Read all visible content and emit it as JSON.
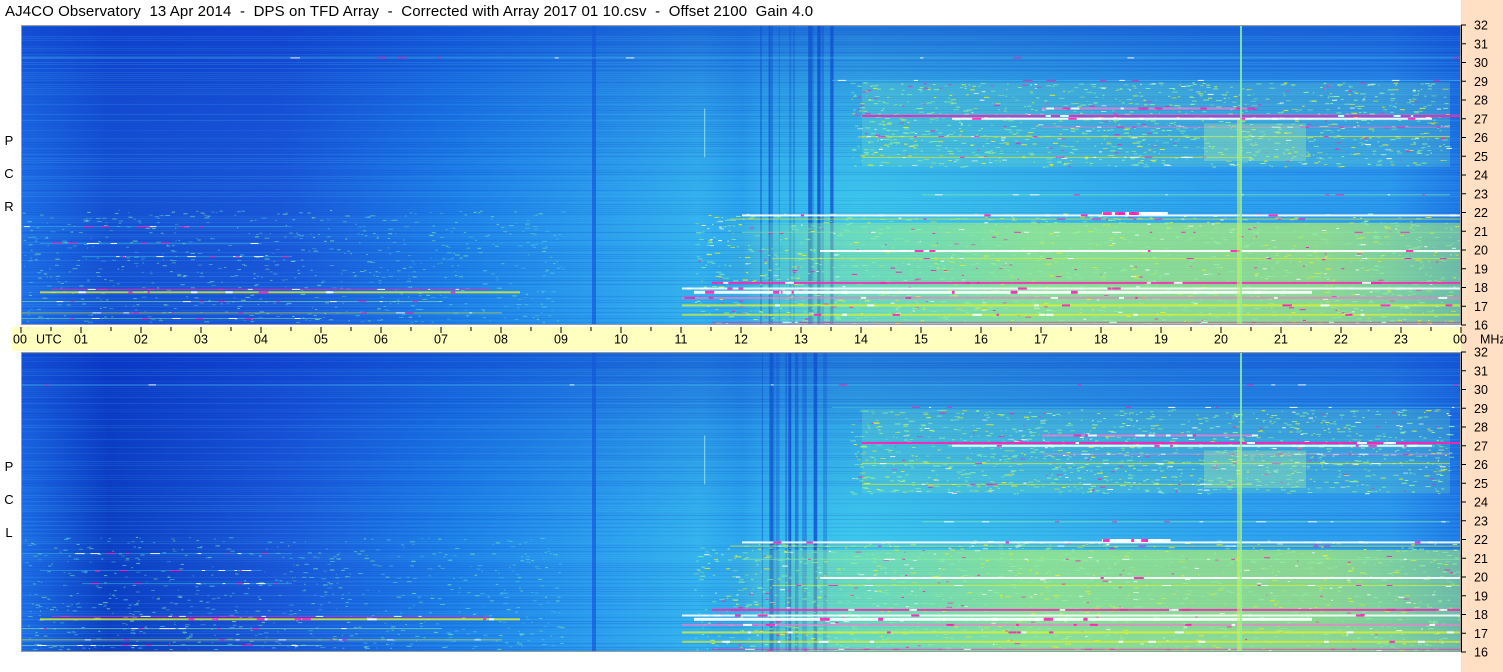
{
  "title": "AJ4CO Observatory  13 Apr 2014  -  DPS on TFD Array  -  Corrected with Array 2017 01 10.csv  -  Offset 2100  Gain 4.0",
  "colors": {
    "background": "#ffffff",
    "time_band": "#ffffc0",
    "right_strip": "#ffe0c4",
    "colormap": [
      "#0a2fb8",
      "#1560e0",
      "#1f8fef",
      "#2aa8ef",
      "#3ccfe8",
      "#8ff0a0",
      "#e8f020",
      "#f07ad0",
      "#ff1fb4",
      "#ffffff"
    ]
  },
  "chart_data": {
    "type": "heatmap",
    "title": "AJ4CO Observatory  13 Apr 2014  -  DPS on TFD Array  -  Corrected with Array 2017 01 10.csv  -  Offset 2100  Gain 4.0",
    "x_axis": {
      "unit_label": "UTC",
      "ticks": [
        "00",
        "01",
        "02",
        "03",
        "04",
        "05",
        "06",
        "07",
        "08",
        "09",
        "10",
        "11",
        "12",
        "13",
        "14",
        "15",
        "16",
        "17",
        "18",
        "19",
        "20",
        "21",
        "22",
        "23",
        "00"
      ],
      "range": [
        0,
        24
      ]
    },
    "y_axis": {
      "unit_label": "MHz",
      "ticks": [
        32,
        31,
        30,
        29,
        28,
        27,
        26,
        25,
        24,
        23,
        22,
        21,
        20,
        19,
        18,
        17,
        16
      ],
      "range": [
        16,
        32
      ]
    },
    "panels": [
      {
        "id": "rcp",
        "letters": [
          "R",
          "C",
          "P"
        ]
      },
      {
        "id": "lcp",
        "letters": [
          "L",
          "C",
          "P"
        ]
      }
    ],
    "colorbar": "blue (low) → cyan → green → yellow → magenta → white (high)"
  }
}
